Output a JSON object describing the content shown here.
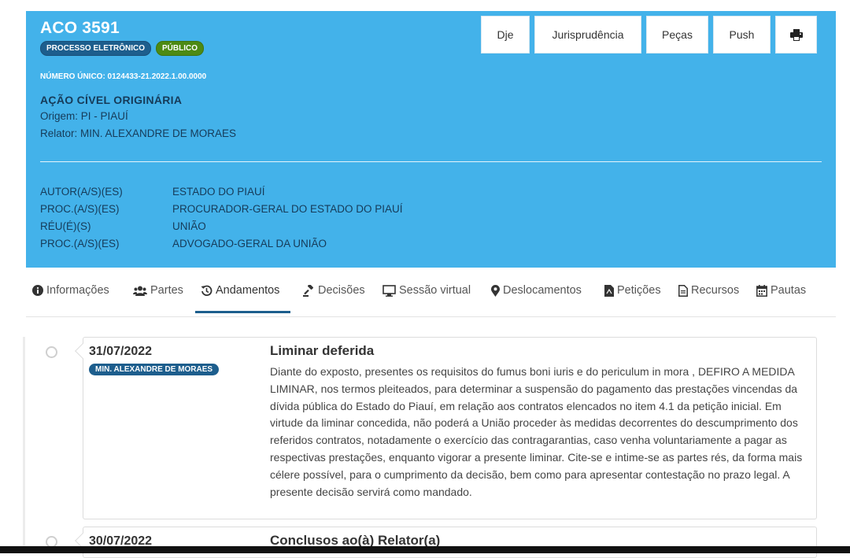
{
  "processo": {
    "title": "ACO 3591",
    "badge_eletronico": "PROCESSO ELETRÔNICO",
    "badge_publico": "PÚBLICO",
    "numero_unico": "NÚMERO ÚNICO: 0124433-21.2022.1.00.0000",
    "classe": "AÇÃO CÍVEL ORIGINÁRIA",
    "origem": "Origem: PI - PIAUÍ",
    "relator": "Relator: MIN. ALEXANDRE DE MORAES"
  },
  "partes": [
    {
      "tipo": "AUTOR(A/S)(ES)",
      "nome": "ESTADO DO PIAUÍ"
    },
    {
      "tipo": "PROC.(A/S)(ES)",
      "nome": "PROCURADOR-GERAL DO ESTADO DO PIAUÍ"
    },
    {
      "tipo": "RÉU(É)(S)",
      "nome": "UNIÃO"
    },
    {
      "tipo": "PROC.(A/S)(ES)",
      "nome": "ADVOGADO-GERAL DA UNIÃO"
    }
  ],
  "buttons": {
    "dje": "Dje",
    "jurisprudencia": "Jurisprudência",
    "pecas": "Peças",
    "push": "Push",
    "print_icon": "printer-icon"
  },
  "tabs": [
    {
      "label": "Informações",
      "icon": "info-icon"
    },
    {
      "label": "Partes",
      "icon": "users-icon"
    },
    {
      "label": "Andamentos",
      "icon": "history-icon",
      "active": true
    },
    {
      "label": "Decisões",
      "icon": "gavel-icon"
    },
    {
      "label": "Sessão virtual",
      "icon": "monitor-icon"
    },
    {
      "label": "Deslocamentos",
      "icon": "map-marker-icon"
    },
    {
      "label": "Petições",
      "icon": "pdf-file-icon"
    },
    {
      "label": "Recursos",
      "icon": "file-icon"
    },
    {
      "label": "Pautas",
      "icon": "calendar-icon"
    }
  ],
  "andamentos": [
    {
      "date": "31/07/2022",
      "ministro": "MIN. ALEXANDRE DE MORAES",
      "title": "Liminar deferida",
      "description": "Diante do exposto, presentes os requisitos do fumus boni iuris e do periculum in mora , DEFIRO A MEDIDA LIMINAR, nos termos pleiteados, para determinar a suspensão do pagamento das prestações vincendas da dívida pública do Estado do Piauí, em relação aos contratos elencados no item 4.1 da petição inicial. Em virtude da liminar concedida, não poderá a União proceder às medidas decorrentes do descumprimento dos referidos contratos, notadamente o exercício das contragarantias, caso venha voluntariamente a pagar as respectivas prestações, enquanto vigorar a presente liminar. Cite-se e intime-se as partes rés, da forma mais célere possível, para o cumprimento da decisão, bem como para apresentar contestação no prazo legal. A presente decisão servirá como mandado."
    },
    {
      "date": "30/07/2022",
      "title": "Conclusos ao(à) Relator(a)"
    }
  ],
  "colors": {
    "header_bg": "#43b2ea",
    "dark_blue": "#1d5e8d",
    "green_badge": "#4d8a13"
  }
}
